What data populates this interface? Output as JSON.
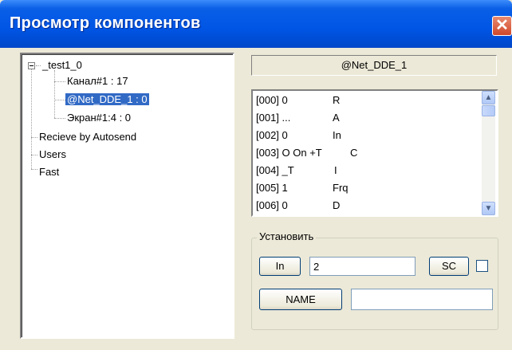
{
  "window": {
    "title": "Просмотр компонентов"
  },
  "tree": {
    "root": "_test1_0",
    "root_children": [
      "Канал#1 : 17",
      "@Net_DDE_1 : 0",
      "Экран#1:4 : 0"
    ],
    "top_items": [
      "Recieve by Autosend",
      "Users",
      "Fast"
    ]
  },
  "detail": {
    "header": "@Net_DDE_1",
    "rows": [
      {
        "index": "[000] 0",
        "code": "R"
      },
      {
        "index": "[001] ...",
        "code": "A"
      },
      {
        "index": "[002] 0",
        "code": "In"
      },
      {
        "index": "[003] O On +T",
        "code": "C"
      },
      {
        "index": "[004] _T",
        "code": "I"
      },
      {
        "index": "[005] 1",
        "code": "Frq"
      },
      {
        "index": "[006] 0",
        "code": "D"
      }
    ]
  },
  "set_group": {
    "label": "Установить",
    "in_button": "In",
    "in_value": "2",
    "sc_button": "SC",
    "sc_checked": false,
    "name_button": "NAME",
    "name_value": ""
  },
  "icons": {
    "close": "close-icon",
    "scroll_up": "arrow-up-icon",
    "scroll_down": "arrow-down-icon"
  },
  "colors": {
    "selection": "#316ac5",
    "titlebar": "#0055e5",
    "close": "#d2482a"
  }
}
